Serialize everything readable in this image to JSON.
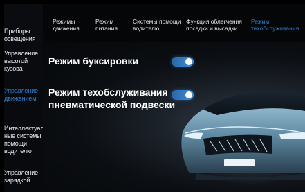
{
  "sidebar": {
    "items": [
      {
        "label": "Приборы освещения",
        "active": false
      },
      {
        "label": "Управление высотой кузова",
        "active": false
      },
      {
        "label": "Управление движением",
        "active": true
      },
      {
        "label": "Интеллектуаль-ные системы помощи водителю",
        "active": false
      },
      {
        "label": "Управление зарядкой",
        "active": false
      }
    ]
  },
  "tabs": [
    {
      "label": "Режимы движения",
      "active": false
    },
    {
      "label": "Режим питания",
      "active": false
    },
    {
      "label": "Системы помощи водителю",
      "active": false
    },
    {
      "label": "Функция облегчения посадки и высадки",
      "active": false
    },
    {
      "label": "Режим техобслуживания",
      "active": true
    }
  ],
  "settings": [
    {
      "label": "Режим буксировки",
      "enabled": true
    },
    {
      "label": "Режим техобслуживания пневматической подвески",
      "enabled": true
    }
  ],
  "colors": {
    "accent": "#2f7fc8",
    "toggle_on": "#3f8fd6",
    "background": "#06080a"
  }
}
